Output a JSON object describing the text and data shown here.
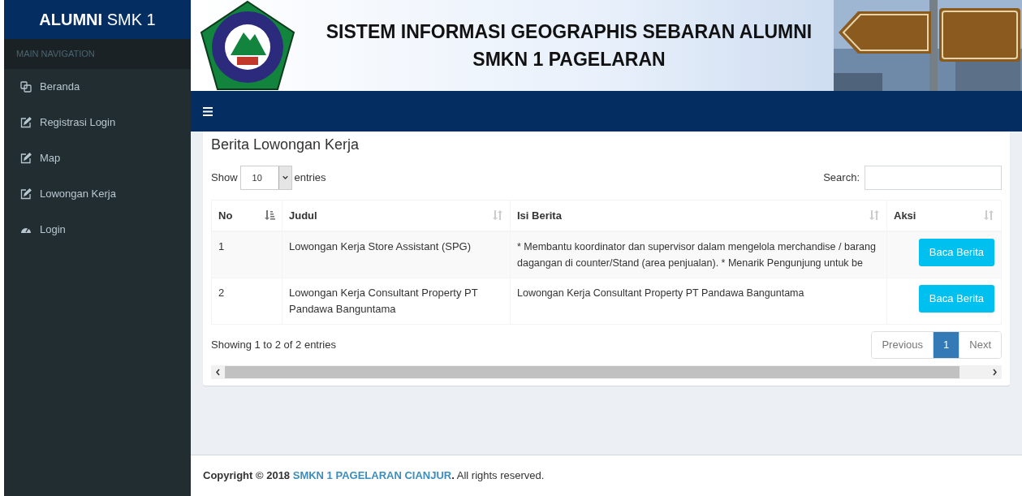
{
  "brand": "**ALUMNI** SMK 1",
  "sidebar": {
    "header": "MAIN NAVIGATION",
    "items": [
      {
        "label": "Beranda",
        "kind": "copy",
        "selected": false
      },
      {
        "label": "Registrasi Login",
        "kind": "edit",
        "selected": false
      },
      {
        "label": "Map",
        "kind": "edit",
        "selected": false
      },
      {
        "label": "Lowongan Kerja",
        "kind": "edit",
        "selected": false
      },
      {
        "label": "Login",
        "kind": "dashboard",
        "selected": false
      }
    ]
  },
  "banner": {
    "title_lines": [
      "SISTEM INFORMASI GEOGRAPHIS SEBARAN ALUMNI",
      "SMKN 1 PAGELARAN"
    ]
  },
  "box": {
    "title": "Berita Lowongan Kerja",
    "length": {
      "show": "Show",
      "value": "10",
      "entries": "entries"
    },
    "search": {
      "label": "Search:"
    },
    "table": {
      "columns": [
        {
          "label": "No",
          "sorted": true
        },
        {
          "label": "Judul",
          "sorted": false
        },
        {
          "label": "Isi Berita",
          "sorted": false
        },
        {
          "label": "Aksi",
          "sorted": false
        }
      ],
      "rows": [
        {
          "no": "1",
          "judul": "Lowongan Kerja Store Assistant (SPG)",
          "isi": "* Membantu koordinator dan supervisor dalam mengelola merchandise / barang dagangan di counter/Stand (area penjualan). * Menarik Pengunjung untuk be",
          "action": "Baca Berita"
        },
        {
          "no": "2",
          "judul": "Lowongan Kerja Consultant Property PT Pandawa Banguntama",
          "isi": "Lowongan Kerja Consultant Property PT Pandawa Banguntama",
          "action": "Baca Berita"
        }
      ]
    },
    "info": "Showing 1 to 2 of 2 entries",
    "pagination": [
      {
        "label": "Previous",
        "selected": false
      },
      {
        "label": "1",
        "selected": true
      },
      {
        "label": "Next",
        "selected": false
      }
    ]
  },
  "footer": {
    "lead": "Copyright © 2018",
    "link": "SMKN 1 PAGELARAN CIANJUR",
    "tail": "**.** All rights reserved."
  }
}
